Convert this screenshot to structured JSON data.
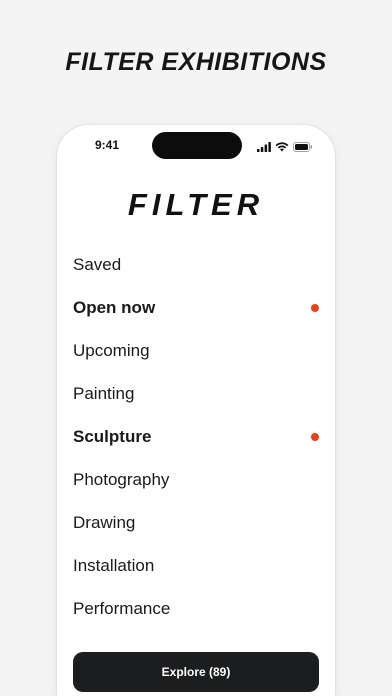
{
  "headline": "FILTER EXHIBITIONS",
  "status_bar": {
    "time": "9:41"
  },
  "app_title": "FILTER",
  "filters": [
    {
      "label": "Saved",
      "active": false
    },
    {
      "label": "Open now",
      "active": true
    },
    {
      "label": "Upcoming",
      "active": false
    },
    {
      "label": "Painting",
      "active": false
    },
    {
      "label": "Sculpture",
      "active": true
    },
    {
      "label": "Photography",
      "active": false
    },
    {
      "label": "Drawing",
      "active": false
    },
    {
      "label": "Installation",
      "active": false
    },
    {
      "label": "Performance",
      "active": false
    }
  ],
  "explore_button": {
    "label": "Explore (89)"
  },
  "colors": {
    "accent": "#e8401c",
    "button_bg": "#1c1d1e",
    "background": "#f4f4f4"
  },
  "icons": [
    "signal-icon",
    "wifi-icon",
    "battery-icon"
  ]
}
